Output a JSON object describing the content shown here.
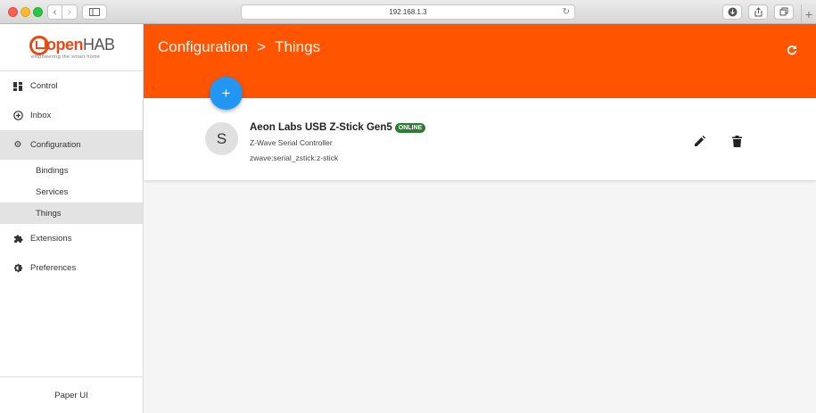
{
  "browser": {
    "url": "192.168.1.3",
    "back_icon": "chevron-left-icon",
    "forward_icon": "chevron-right-icon"
  },
  "sidebar": {
    "logo_open": "open",
    "logo_hab": "HAB",
    "logo_tagline": "empowering the smart home",
    "items": [
      {
        "label": "Control",
        "icon": "dashboard-icon"
      },
      {
        "label": "Inbox",
        "icon": "add-circle-icon"
      },
      {
        "label": "Configuration",
        "icon": "gear-icon"
      },
      {
        "label": "Extensions",
        "icon": "puzzle-icon"
      },
      {
        "label": "Preferences",
        "icon": "contrast-icon"
      }
    ],
    "subitems": [
      {
        "label": "Bindings"
      },
      {
        "label": "Services"
      },
      {
        "label": "Things"
      }
    ],
    "footer": "Paper UI"
  },
  "header": {
    "breadcrumb_root": "Configuration",
    "breadcrumb_sep": ">",
    "breadcrumb_current": "Things",
    "refresh_icon": "refresh-icon",
    "fab_label": "+",
    "accent_color": "#ff5500",
    "fab_color": "#2196f3"
  },
  "thing": {
    "avatar_letter": "S",
    "name": "Aeon Labs USB Z-Stick Gen5",
    "status": "ONLINE",
    "status_color": "#2e7d32",
    "type": "Z-Wave Serial Controller",
    "uid": "zwave:serial_zstick:z-stick"
  }
}
